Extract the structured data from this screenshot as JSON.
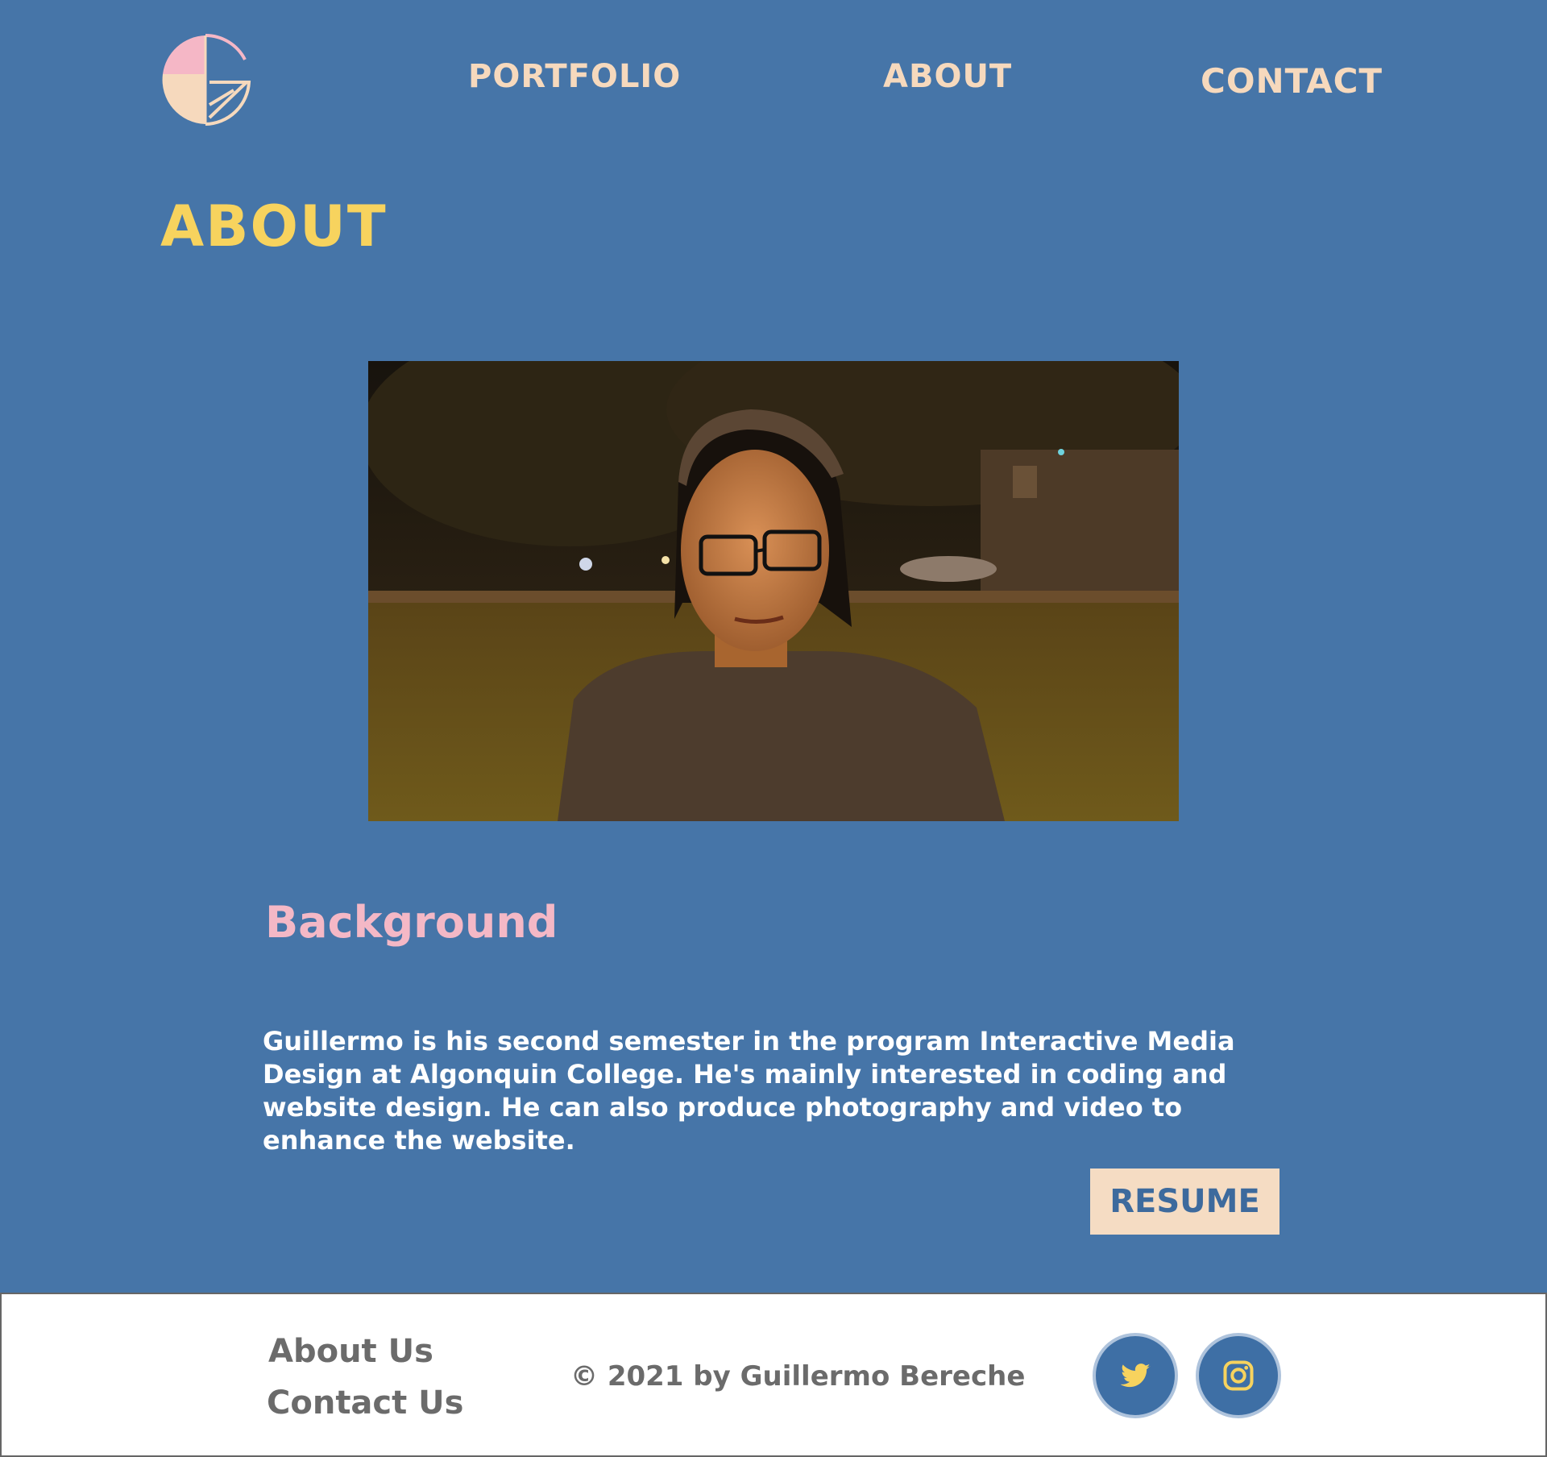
{
  "nav": {
    "portfolio": "PORTFOLIO",
    "about": "ABOUT",
    "contact": "CONTACT"
  },
  "page": {
    "title": "ABOUT"
  },
  "background": {
    "heading": "Background",
    "bio": "Guillermo is his second semester in the program Interactive Media Design at Algonquin College. He's mainly interested in coding and website design. He can also produce photography and video to enhance the website.",
    "resume_label": "RESUME"
  },
  "footer": {
    "about_us": "About Us",
    "contact_us": "Contact Us",
    "copyright": "© 2021 by Guillermo Bereche",
    "social": [
      "twitter-icon",
      "instagram-icon"
    ]
  },
  "colors": {
    "page_bg": "#4675a8",
    "nav_text": "#f6d9bd",
    "title": "#f7d35e",
    "heading_pink": "#f4b8c6",
    "button_bg": "#f5dcc3",
    "footer_text": "#6b6b6b",
    "social_icon": "#f7d35e"
  }
}
